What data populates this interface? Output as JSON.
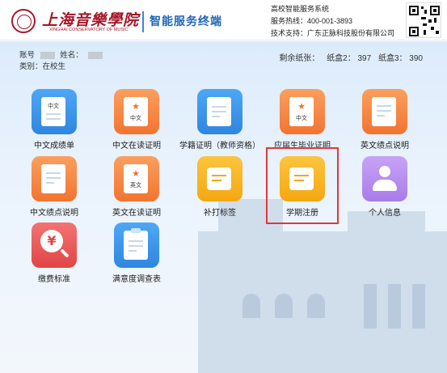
{
  "header": {
    "school_name_cn": "上海音樂學院",
    "school_name_en": "XINGHAI CONSERVATORY OF MUSIC",
    "terminal_title": "智能服务终端",
    "system_name": "高校智能服务系统",
    "hotline": "服务热线：400-001-3893",
    "support": "技术支持：广东正脉科技股份有限公司"
  },
  "user": {
    "account_label": "账号",
    "name_label": "姓名：",
    "category": "类别：在校生"
  },
  "paper": {
    "remaining_label": "剩余纸张：",
    "box2": "纸盒2：  397",
    "box3": "纸盒3：  390"
  },
  "tiles": [
    {
      "label": "中文成绩单",
      "icon": "document-icon",
      "color": "#2f86e0",
      "badge": "中文"
    },
    {
      "label": "中文在读证明",
      "icon": "certificate-icon",
      "color": "#f27430",
      "badge": "中文"
    },
    {
      "label": "学籍证明（教师资格）",
      "icon": "certificate-document-icon",
      "color": "#2f86e0"
    },
    {
      "label": "应届生毕业证明",
      "icon": "certificate-icon",
      "color": "#f27430",
      "badge": "中文"
    },
    {
      "label": "英文绩点说明",
      "icon": "document-icon",
      "color": "#f27430"
    },
    {
      "label": "中文绩点说明",
      "icon": "document-icon",
      "color": "#f27430"
    },
    {
      "label": "英文在读证明",
      "icon": "certificate-icon",
      "color": "#f27430",
      "badge": "英文"
    },
    {
      "label": "补打标签",
      "icon": "tag-icon",
      "color": "#f5a712"
    },
    {
      "label": "学期注册",
      "icon": "tag-icon",
      "color": "#f5a712"
    },
    {
      "label": "个人信息",
      "icon": "person-icon",
      "color": "#a87cea"
    },
    {
      "label": "缴费标准",
      "icon": "yuan-search-icon",
      "color": "#e14545"
    },
    {
      "label": "满意度调查表",
      "icon": "clipboard-icon",
      "color": "#2f86e0"
    }
  ]
}
